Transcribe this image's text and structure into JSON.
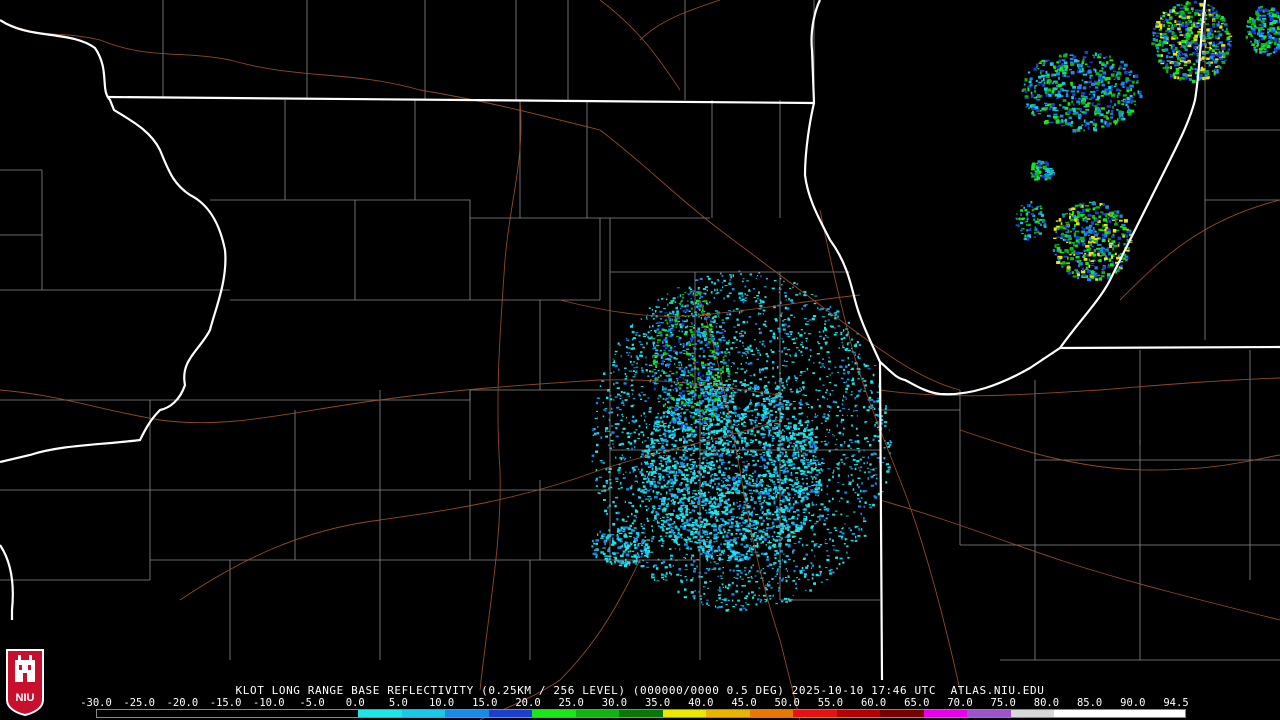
{
  "caption": "KLOT LONG RANGE BASE REFLECTIVITY (0.25KM / 256 LEVEL) (000000/0000 0.5 DEG) 2025-10-10 17:46 UTC  ATLAS.NIU.EDU",
  "scale": {
    "labels": [
      "-30.0",
      "-25.0",
      "-20.0",
      "-15.0",
      "-10.0",
      "-5.0",
      "0.0",
      "5.0",
      "10.0",
      "15.0",
      "20.0",
      "25.0",
      "30.0",
      "35.0",
      "40.0",
      "45.0",
      "50.0",
      "55.0",
      "60.0",
      "65.0",
      "70.0",
      "75.0",
      "80.0",
      "85.0",
      "90.0",
      "94.5"
    ],
    "colors": [
      "#000000",
      "#000000",
      "#000000",
      "#000000",
      "#000000",
      "#000000",
      "#1fe6e6",
      "#1ac8e8",
      "#1a8ae8",
      "#1a40d0",
      "#18e818",
      "#10b410",
      "#087808",
      "#e8e800",
      "#e8b400",
      "#e87800",
      "#e81010",
      "#b40000",
      "#780000",
      "#e800e8",
      "#9c54c8",
      "#d8d8d8",
      "#ffffff",
      "#ffffff",
      "#ffffff"
    ]
  },
  "logo": {
    "text": "NIU",
    "color": "#c8102e"
  },
  "map_layers": [
    "state-boundaries",
    "county-boundaries",
    "highways",
    "lake-michigan-shoreline"
  ],
  "radar": {
    "site": "KLOT"
  }
}
